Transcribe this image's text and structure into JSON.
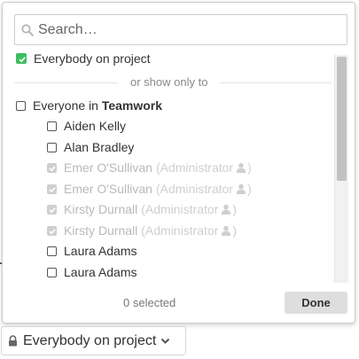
{
  "search": {
    "placeholder": "Search…",
    "value": ""
  },
  "everybody_option": {
    "label": "Everybody on project",
    "checked": true
  },
  "divider_label": "or show only to",
  "team_option": {
    "prefix": "Everyone in ",
    "team_name": "Teamwork",
    "checked": false
  },
  "users": [
    {
      "name": "Aiden Kelly",
      "admin_label": "",
      "checked": false,
      "disabled": false
    },
    {
      "name": "Alan Bradley",
      "admin_label": "",
      "checked": false,
      "disabled": false
    },
    {
      "name": "Emer O'Sullivan",
      "admin_label": "(Administrator",
      "admin_close": ")",
      "checked": true,
      "disabled": true
    },
    {
      "name": "Emer O'Sullivan",
      "admin_label": "(Administrator",
      "admin_close": ")",
      "checked": true,
      "disabled": true
    },
    {
      "name": "Kirsty Durnall",
      "admin_label": "(Administrator",
      "admin_close": ")",
      "checked": true,
      "disabled": true
    },
    {
      "name": "Kirsty Durnall",
      "admin_label": "(Administrator",
      "admin_close": ")",
      "checked": true,
      "disabled": true
    },
    {
      "name": "Laura Adams",
      "admin_label": "",
      "checked": false,
      "disabled": false
    },
    {
      "name": "Laura Adams",
      "admin_label": "",
      "checked": false,
      "disabled": false
    }
  ],
  "footer": {
    "selected_count_text": "0 selected",
    "done_label": "Done"
  },
  "privacy_button": {
    "label": "Everybody on project",
    "icon": "lock-icon"
  },
  "colors": {
    "checkbox_green": "#3ebd61",
    "muted_text": "#b9b9b9",
    "done_bg": "#dedede"
  }
}
